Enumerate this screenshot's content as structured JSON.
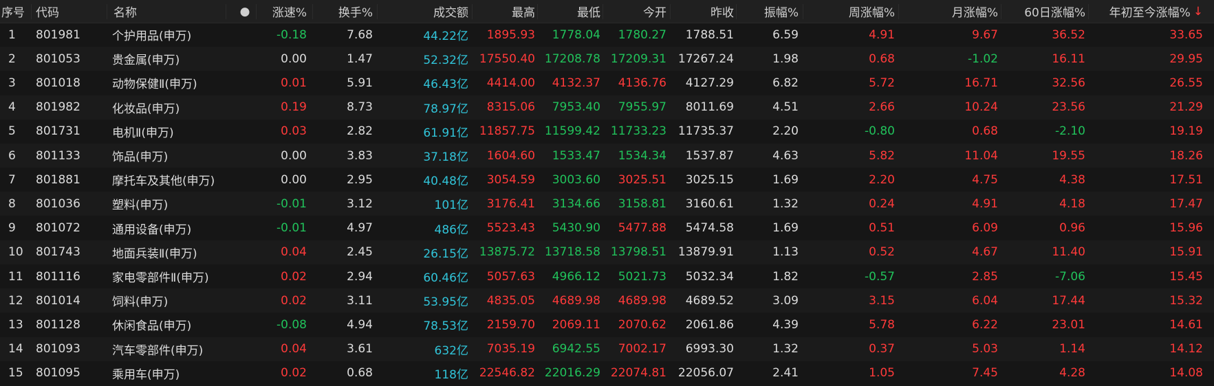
{
  "header": {
    "seq": "序号",
    "code": "代码",
    "name": "名称",
    "dot": "●",
    "speed": "涨速%",
    "turnover": "换手%",
    "volume": "成交额",
    "high": "最高",
    "low": "最低",
    "open": "今开",
    "prev_close": "昨收",
    "amplitude": "振幅%",
    "week_chg": "周涨幅%",
    "month_chg": "月涨幅%",
    "d60_chg": "60日涨幅%",
    "ytd_chg": "年初至今涨幅%",
    "sort_arrow": "↓"
  },
  "colors": {
    "up": "#ff3a3a",
    "down": "#21c25b",
    "flat": "#dcdcdc",
    "volume": "#31c4d9"
  },
  "rows": [
    {
      "seq": "1",
      "code": "801981",
      "name": "个护用品(申万)",
      "speed": "-0.18",
      "turnover": "7.68",
      "volume": "44.22亿",
      "high": "1895.93",
      "low": "1778.04",
      "open": "1780.27",
      "prev_close": "1788.51",
      "amplitude": "6.59",
      "week_chg": "4.91",
      "month_chg": "9.67",
      "d60_chg": "36.52",
      "ytd_chg": "33.65"
    },
    {
      "seq": "2",
      "code": "801053",
      "name": "贵金属(申万)",
      "speed": "0.00",
      "turnover": "1.47",
      "volume": "52.32亿",
      "high": "17550.40",
      "low": "17208.78",
      "open": "17209.31",
      "prev_close": "17267.24",
      "amplitude": "1.98",
      "week_chg": "0.68",
      "month_chg": "-1.02",
      "d60_chg": "16.11",
      "ytd_chg": "29.95"
    },
    {
      "seq": "3",
      "code": "801018",
      "name": "动物保健Ⅱ(申万)",
      "speed": "0.01",
      "turnover": "5.91",
      "volume": "46.43亿",
      "high": "4414.00",
      "low": "4132.37",
      "open": "4136.76",
      "prev_close": "4127.29",
      "amplitude": "6.82",
      "week_chg": "5.72",
      "month_chg": "16.71",
      "d60_chg": "32.56",
      "ytd_chg": "26.55"
    },
    {
      "seq": "4",
      "code": "801982",
      "name": "化妆品(申万)",
      "speed": "0.19",
      "turnover": "8.73",
      "volume": "78.97亿",
      "high": "8315.06",
      "low": "7953.40",
      "open": "7955.97",
      "prev_close": "8011.69",
      "amplitude": "4.51",
      "week_chg": "2.66",
      "month_chg": "10.24",
      "d60_chg": "23.56",
      "ytd_chg": "21.29"
    },
    {
      "seq": "5",
      "code": "801731",
      "name": "电机Ⅱ(申万)",
      "speed": "0.03",
      "turnover": "2.82",
      "volume": "61.91亿",
      "high": "11857.75",
      "low": "11599.42",
      "open": "11733.23",
      "prev_close": "11735.37",
      "amplitude": "2.20",
      "week_chg": "-0.80",
      "month_chg": "0.68",
      "d60_chg": "-2.10",
      "ytd_chg": "19.19"
    },
    {
      "seq": "6",
      "code": "801133",
      "name": "饰品(申万)",
      "speed": "0.00",
      "turnover": "3.83",
      "volume": "37.18亿",
      "high": "1604.60",
      "low": "1533.47",
      "open": "1534.34",
      "prev_close": "1537.87",
      "amplitude": "4.63",
      "week_chg": "5.82",
      "month_chg": "11.04",
      "d60_chg": "19.55",
      "ytd_chg": "18.26"
    },
    {
      "seq": "7",
      "code": "801881",
      "name": "摩托车及其他(申万)",
      "speed": "0.00",
      "turnover": "2.95",
      "volume": "40.48亿",
      "high": "3054.59",
      "low": "3003.60",
      "open": "3025.51",
      "prev_close": "3025.15",
      "amplitude": "1.69",
      "week_chg": "2.20",
      "month_chg": "4.75",
      "d60_chg": "4.38",
      "ytd_chg": "17.51"
    },
    {
      "seq": "8",
      "code": "801036",
      "name": "塑料(申万)",
      "speed": "-0.01",
      "turnover": "3.12",
      "volume": "101亿",
      "high": "3176.41",
      "low": "3134.66",
      "open": "3158.81",
      "prev_close": "3160.61",
      "amplitude": "1.32",
      "week_chg": "0.24",
      "month_chg": "4.91",
      "d60_chg": "4.18",
      "ytd_chg": "17.47"
    },
    {
      "seq": "9",
      "code": "801072",
      "name": "通用设备(申万)",
      "speed": "-0.01",
      "turnover": "4.97",
      "volume": "486亿",
      "high": "5523.43",
      "low": "5430.90",
      "open": "5477.88",
      "prev_close": "5474.58",
      "amplitude": "1.69",
      "week_chg": "0.51",
      "month_chg": "6.09",
      "d60_chg": "0.96",
      "ytd_chg": "15.96"
    },
    {
      "seq": "10",
      "code": "801743",
      "name": "地面兵装Ⅱ(申万)",
      "speed": "0.04",
      "turnover": "2.45",
      "volume": "26.15亿",
      "high": "13875.72",
      "low": "13718.58",
      "open": "13798.51",
      "prev_close": "13879.91",
      "amplitude": "1.13",
      "week_chg": "0.52",
      "month_chg": "4.67",
      "d60_chg": "11.40",
      "ytd_chg": "15.91"
    },
    {
      "seq": "11",
      "code": "801116",
      "name": "家电零部件Ⅱ(申万)",
      "speed": "0.02",
      "turnover": "2.94",
      "volume": "60.46亿",
      "high": "5057.63",
      "low": "4966.12",
      "open": "5021.73",
      "prev_close": "5032.34",
      "amplitude": "1.82",
      "week_chg": "-0.57",
      "month_chg": "2.85",
      "d60_chg": "-7.06",
      "ytd_chg": "15.45"
    },
    {
      "seq": "12",
      "code": "801014",
      "name": "饲料(申万)",
      "speed": "0.02",
      "turnover": "3.11",
      "volume": "53.95亿",
      "high": "4835.05",
      "low": "4689.98",
      "open": "4689.98",
      "prev_close": "4689.52",
      "amplitude": "3.09",
      "week_chg": "3.15",
      "month_chg": "6.04",
      "d60_chg": "17.44",
      "ytd_chg": "15.32"
    },
    {
      "seq": "13",
      "code": "801128",
      "name": "休闲食品(申万)",
      "speed": "-0.08",
      "turnover": "4.94",
      "volume": "78.53亿",
      "high": "2159.70",
      "low": "2069.11",
      "open": "2070.62",
      "prev_close": "2061.86",
      "amplitude": "4.39",
      "week_chg": "5.78",
      "month_chg": "6.22",
      "d60_chg": "23.01",
      "ytd_chg": "14.61"
    },
    {
      "seq": "14",
      "code": "801093",
      "name": "汽车零部件(申万)",
      "speed": "0.04",
      "turnover": "3.61",
      "volume": "632亿",
      "high": "7035.19",
      "low": "6942.55",
      "open": "7002.17",
      "prev_close": "6993.30",
      "amplitude": "1.32",
      "week_chg": "0.37",
      "month_chg": "5.03",
      "d60_chg": "1.14",
      "ytd_chg": "14.12"
    },
    {
      "seq": "15",
      "code": "801095",
      "name": "乘用车(申万)",
      "speed": "0.02",
      "turnover": "0.68",
      "volume": "118亿",
      "high": "22546.82",
      "low": "22016.29",
      "open": "22074.81",
      "prev_close": "22056.07",
      "amplitude": "2.41",
      "week_chg": "1.05",
      "month_chg": "7.45",
      "d60_chg": "4.28",
      "ytd_chg": "14.08"
    }
  ]
}
